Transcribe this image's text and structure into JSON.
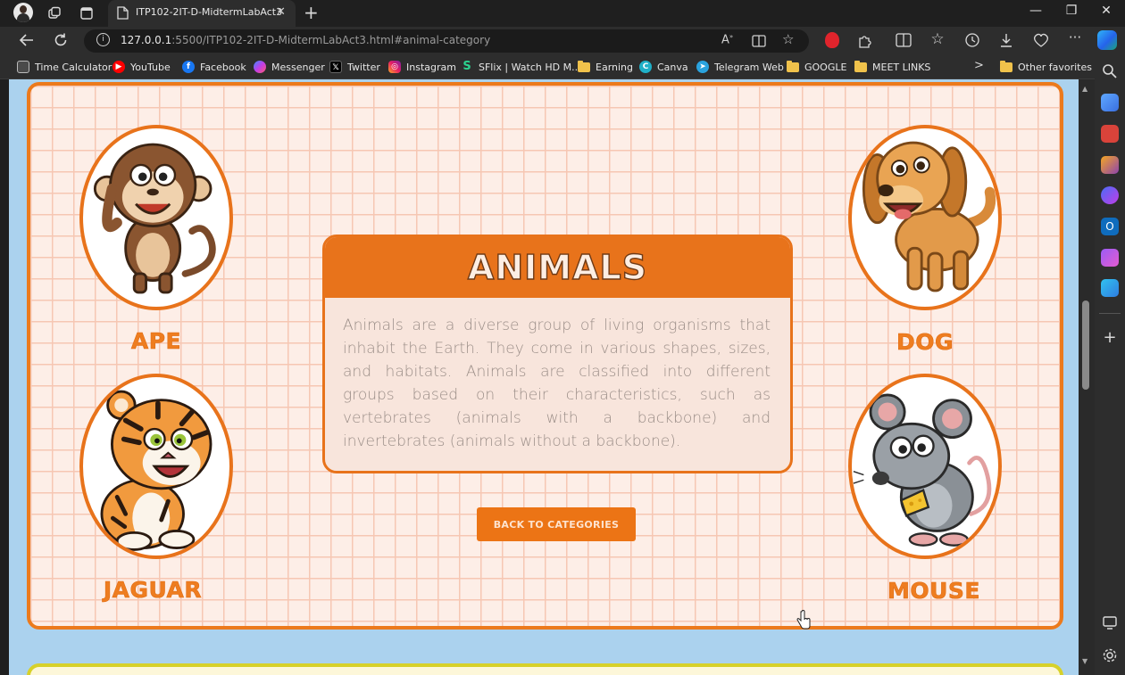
{
  "browser": {
    "tab": {
      "title": "ITP102-2IT-D-MidtermLabAct3",
      "close_glyph": "✕"
    },
    "new_tab_glyph": "+",
    "window_controls": {
      "minimize": "—",
      "maximize": "❐",
      "close": "✕"
    },
    "url": {
      "host": "127.0.0.1",
      "rest": ":5500/ITP102-2IT-D-MidtermLabAct3.html#animal-category"
    }
  },
  "bookmarks": [
    {
      "label": "Time Calculator",
      "icon": "grid-icon",
      "color": "#5a5a5a"
    },
    {
      "label": "YouTube",
      "icon": "youtube-icon",
      "color": "#ff0000"
    },
    {
      "label": "Facebook",
      "icon": "facebook-icon",
      "color": "#1877f2"
    },
    {
      "label": "Messenger",
      "icon": "messenger-icon",
      "color": "#a034f0"
    },
    {
      "label": "Twitter",
      "icon": "x-icon",
      "color": "#000000"
    },
    {
      "label": "Instagram",
      "icon": "instagram-icon",
      "color": "#d62976"
    },
    {
      "label": "SFlix | Watch HD M...",
      "icon": "sflix-icon",
      "color": "#1e9e6e"
    },
    {
      "label": "Earning",
      "icon": "folder-icon",
      "color": "#f0c24b"
    },
    {
      "label": "Canva",
      "icon": "canva-icon",
      "color": "#1fb0c8"
    },
    {
      "label": "Telegram Web",
      "icon": "telegram-icon",
      "color": "#2aa3de"
    },
    {
      "label": "GOOGLE",
      "icon": "folder-icon",
      "color": "#f0c24b"
    },
    {
      "label": "MEET LINKS",
      "icon": "folder-icon",
      "color": "#f0c24b"
    },
    {
      "label": "Other favorites",
      "icon": "folder-icon",
      "color": "#f0c24b"
    }
  ],
  "page": {
    "info_card": {
      "title": "ANIMALS",
      "body": "Animals are a diverse group of living organisms that inhabit the Earth. They come in various shapes, sizes, and habitats. Animals are classified into different groups based on their characteristics, such as vertebrates (animals with a backbone) and invertebrates (animals without a backbone)."
    },
    "animals": [
      {
        "name": "APE"
      },
      {
        "name": "DOG"
      },
      {
        "name": "JAGUAR"
      },
      {
        "name": "MOUSE"
      }
    ],
    "back_button": "BACK TO CATEGORIES"
  },
  "colors": {
    "accent": "#e8731b",
    "page_background": "#abd2ee",
    "panel_background": "#fdeee7",
    "grid_lines": "#f6c7b3"
  }
}
